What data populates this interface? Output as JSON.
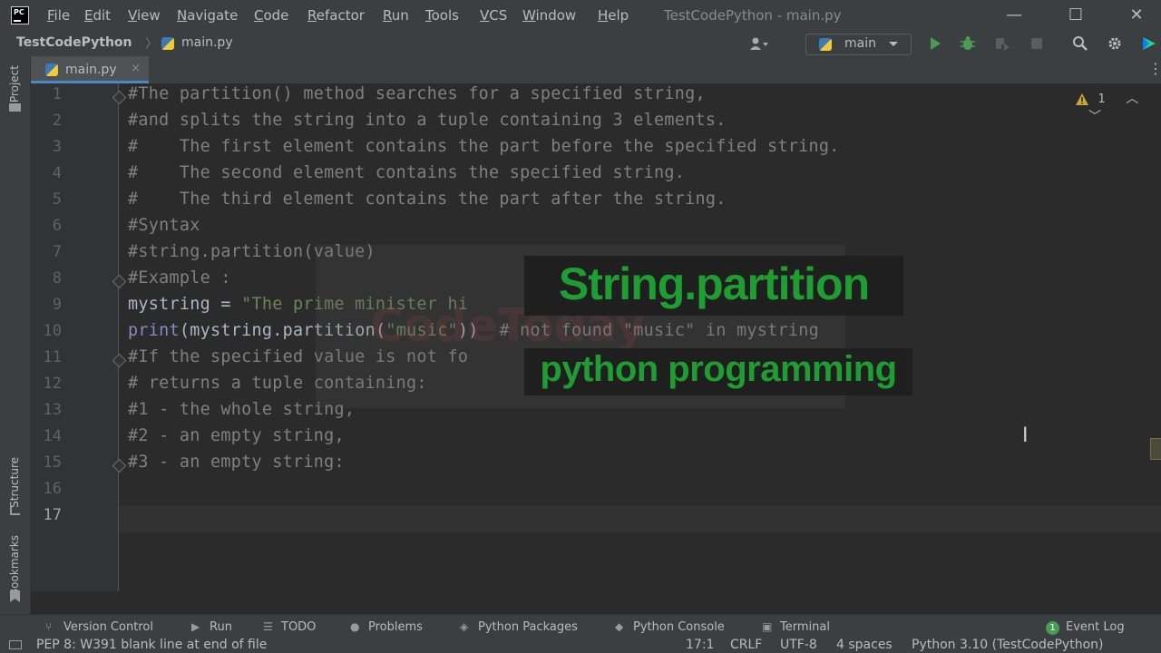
{
  "menubar": {
    "app_logo": "PC",
    "items": [
      "File",
      "Edit",
      "View",
      "Navigate",
      "Code",
      "Refactor",
      "Run",
      "Tools",
      "VCS",
      "Window",
      "Help"
    ],
    "window_title": "TestCodePython - main.py",
    "controls": {
      "minimize": "—",
      "maximize": "☐",
      "close": "✕"
    }
  },
  "navbar": {
    "project": "TestCodePython",
    "file": "main.py",
    "run_config": "main"
  },
  "leftstrip": {
    "project": "Project",
    "structure": "Structure",
    "bookmarks": "Bookmarks"
  },
  "tabs": [
    {
      "label": "main.py",
      "close": "×"
    }
  ],
  "editor": {
    "warning_count": "1",
    "current_line": 17,
    "lines": [
      {
        "n": "1",
        "segments": [
          {
            "t": "#The partition() method searches for a specified string,",
            "c": "cmt"
          }
        ]
      },
      {
        "n": "2",
        "segments": [
          {
            "t": "#and splits the string into a tuple containing 3 elements.",
            "c": "cmt"
          }
        ]
      },
      {
        "n": "3",
        "segments": [
          {
            "t": "#    The first element contains the part before the specified string.",
            "c": "cmt"
          }
        ]
      },
      {
        "n": "4",
        "segments": [
          {
            "t": "#    The second element contains the specified string.",
            "c": "cmt"
          }
        ]
      },
      {
        "n": "5",
        "segments": [
          {
            "t": "#    The third element contains the part after the string.",
            "c": "cmt"
          }
        ]
      },
      {
        "n": "6",
        "segments": [
          {
            "t": "#Syntax",
            "c": "cmt"
          }
        ]
      },
      {
        "n": "7",
        "segments": [
          {
            "t": "#string.partition(value)",
            "c": "cmt"
          }
        ]
      },
      {
        "n": "8",
        "segments": [
          {
            "t": "#Example :",
            "c": "cmt"
          }
        ]
      },
      {
        "n": "9",
        "segments": [
          {
            "t": "mystring = ",
            "c": "id"
          },
          {
            "t": "\"The prime minister hi",
            "c": "str"
          }
        ]
      },
      {
        "n": "10",
        "segments": [
          {
            "t": "print",
            "c": "builtin"
          },
          {
            "t": "(mystring.partition(",
            "c": "id"
          },
          {
            "t": "\"music\"",
            "c": "str"
          },
          {
            "t": "))  ",
            "c": "id"
          },
          {
            "t": "# not found \"music\" in mystring",
            "c": "cmt"
          }
        ]
      },
      {
        "n": "11",
        "segments": [
          {
            "t": "#If the specified value is not fo",
            "c": "cmt"
          }
        ]
      },
      {
        "n": "12",
        "segments": [
          {
            "t": "# returns a tuple containing:",
            "c": "cmt"
          }
        ]
      },
      {
        "n": "13",
        "segments": [
          {
            "t": "#1 - the whole string,",
            "c": "cmt"
          }
        ]
      },
      {
        "n": "14",
        "segments": [
          {
            "t": "#2 - an empty string,",
            "c": "cmt"
          }
        ]
      },
      {
        "n": "15",
        "segments": [
          {
            "t": "#3 - an empty string:",
            "c": "cmt"
          }
        ]
      },
      {
        "n": "16",
        "segments": []
      },
      {
        "n": "17",
        "segments": []
      }
    ],
    "fold_lines": [
      1,
      8,
      11,
      15
    ]
  },
  "overlay": {
    "title": "String.partition",
    "subtitle": "python programming",
    "watermark": "CodeToday"
  },
  "bottom_tools": [
    {
      "icon": "⑂",
      "label": "Version Control"
    },
    {
      "icon": "▶",
      "label": "Run"
    },
    {
      "icon": "☰",
      "label": "TODO"
    },
    {
      "icon": "●",
      "label": "Problems"
    },
    {
      "icon": "◈",
      "label": "Python Packages"
    },
    {
      "icon": "◆",
      "label": "Python Console"
    },
    {
      "icon": "▣",
      "label": "Terminal"
    }
  ],
  "event_log": {
    "count": "1",
    "label": "Event Log"
  },
  "status": {
    "message": "PEP 8: W391 blank line at end of file",
    "position": "17:1",
    "line_sep": "CRLF",
    "encoding": "UTF-8",
    "indent": "4 spaces",
    "interpreter": "Python 3.10 (TestCodePython)"
  },
  "colors": {
    "comment": "#808080",
    "identifier": "#a9b7c6",
    "string": "#6a8759",
    "builtin": "#8888c6",
    "banner_text": "#1f9d32"
  }
}
